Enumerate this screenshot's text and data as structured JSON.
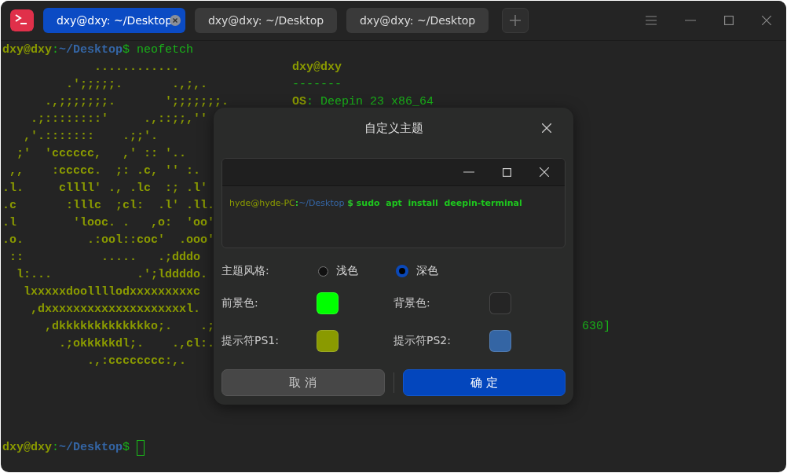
{
  "tabs": [
    {
      "label": "dxy@dxy: ~/Desktop",
      "selected": true
    },
    {
      "label": "dxy@dxy: ~/Desktop",
      "selected": false
    },
    {
      "label": "dxy@dxy: ~/Desktop",
      "selected": false
    }
  ],
  "terminal": {
    "lines": [
      {
        "kind": "prompt",
        "user": "dxy@dxy",
        "sep": ":",
        "path": "~/Desktop",
        "sign": "$",
        "command": " neofetch"
      },
      {
        "kind": "art",
        "art": "             ............",
        "info": [
          {
            "text": "dxy@dxy",
            "kind": "key"
          }
        ]
      },
      {
        "kind": "art",
        "art": "         .';;;;;.       .,;,.",
        "info": [
          {
            "text": "-------",
            "kind": "value"
          }
        ]
      },
      {
        "kind": "art",
        "art": "      .,;;;;;;;.       ';;;;;;;.",
        "info": [
          {
            "text": "OS",
            "kind": "key"
          },
          {
            "text": ": Deepin 23 x86_64",
            "kind": "value"
          }
        ]
      },
      {
        "kind": "art",
        "art": "    .;::::::::'     .,::;;,''"
      },
      {
        "kind": "art",
        "art": "   ,'.:::::::    .;;'."
      },
      {
        "kind": "art",
        "art": "  ;'  'cccccc,   ,' :: '.."
      },
      {
        "kind": "art",
        "art": " ,,    :ccccc.  ;: .c, '' :."
      },
      {
        "kind": "art",
        "art": ".l.     cllll' ., .lc  :; .l'"
      },
      {
        "kind": "art",
        "art": ".c       :lllc  ;cl:  .l' .ll."
      },
      {
        "kind": "art",
        "art": ".l        'looc. .   ,o:  'oo'"
      },
      {
        "kind": "art",
        "art": ".o.         .:ool::coc'  .ooo'"
      },
      {
        "kind": "art",
        "art": " ::           .....   .;dddo"
      },
      {
        "kind": "art",
        "art": "  l:...            .';lddddo."
      },
      {
        "kind": "art",
        "art": "   lxxxxxdoollllodxxxxxxxxxc"
      },
      {
        "kind": "art",
        "art": "    ,dxxxxxxxxxxxxxxxxxxxxl."
      },
      {
        "kind": "art",
        "art": "      ,dkkkkkkkkkkkkko;.    .;",
        "tail": "630]"
      },
      {
        "kind": "art",
        "art": "        .;okkkkkdl;.    .,cl:."
      },
      {
        "kind": "art",
        "art": "            .,:cccccccc:,."
      },
      {
        "kind": "blank"
      },
      {
        "kind": "blank"
      },
      {
        "kind": "blank"
      },
      {
        "kind": "blank"
      },
      {
        "kind": "prompt",
        "user": "dxy@dxy",
        "sep": ":",
        "path": "~/Desktop",
        "sign": "$",
        "cursor": true
      }
    ]
  },
  "dialog": {
    "title": "自定义主题",
    "preview": {
      "user": "hyde@hyde-PC",
      "sep": ":",
      "path": "~/Desktop",
      "sign": " $",
      "command": " sudo  apt  install  deepin-terminal"
    },
    "style_label": "主题风格:",
    "styles": [
      {
        "label": "浅色",
        "selected": false
      },
      {
        "label": "深色",
        "selected": true
      }
    ],
    "colors": [
      {
        "label": "前景色:",
        "color": "#00ff00"
      },
      {
        "label": "背景色:",
        "color": "#252525"
      },
      {
        "label": "提示符PS1:",
        "color": "#8a9a00"
      },
      {
        "label": "提示符PS2:",
        "color": "#3465a4"
      }
    ],
    "buttons": [
      {
        "label": "取 消",
        "kind": "secondary"
      },
      {
        "label": "确 定",
        "kind": "primary"
      }
    ]
  }
}
